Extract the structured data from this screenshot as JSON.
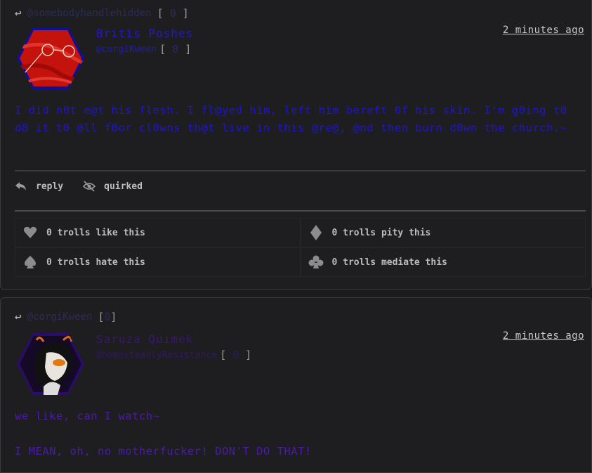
{
  "posts": [
    {
      "reply_to_handle": "@somebodyhandlehidden",
      "reply_to_badge": "0",
      "display_name": "Britis Poshes",
      "name_color": "#2617c9",
      "handle": "@corgiKween",
      "handle_badge": "0",
      "timestamp": "2 minutes ago",
      "text": "I did n0t e@t his flesh. I fl@yed him, left him bereft 0f his skin. I'm g0ing t0 d0 it t0 @ll f0or cl0wns th@t live in this @re@, @nd then burn d0wn the church.~",
      "text_color": "#1f14d1",
      "actions": {
        "reply": "reply",
        "quirked": "quirked"
      },
      "reactions": {
        "like": "0 trolls like this",
        "pity": "0 trolls pity this",
        "hate": "0 trolls hate this",
        "mediate": "0 trolls mediate this"
      },
      "avatar_icon": "red-cloth-with-glasses"
    },
    {
      "reply_to_handle": "@corgiKween",
      "reply_to_badge": "0",
      "display_name": "Saruza Quimek",
      "name_color": "#3a1478",
      "handle": "@homesteadlyResistance",
      "handle_badge": "0",
      "timestamp": "2 minutes ago",
      "lines": [
        "we like, can I watch~",
        "I MEAN, oh, no motherfucker! DON'T DO THAT!"
      ],
      "text_color": "#4b1aa8",
      "avatar_icon": "troll-girl-portrait"
    }
  ]
}
